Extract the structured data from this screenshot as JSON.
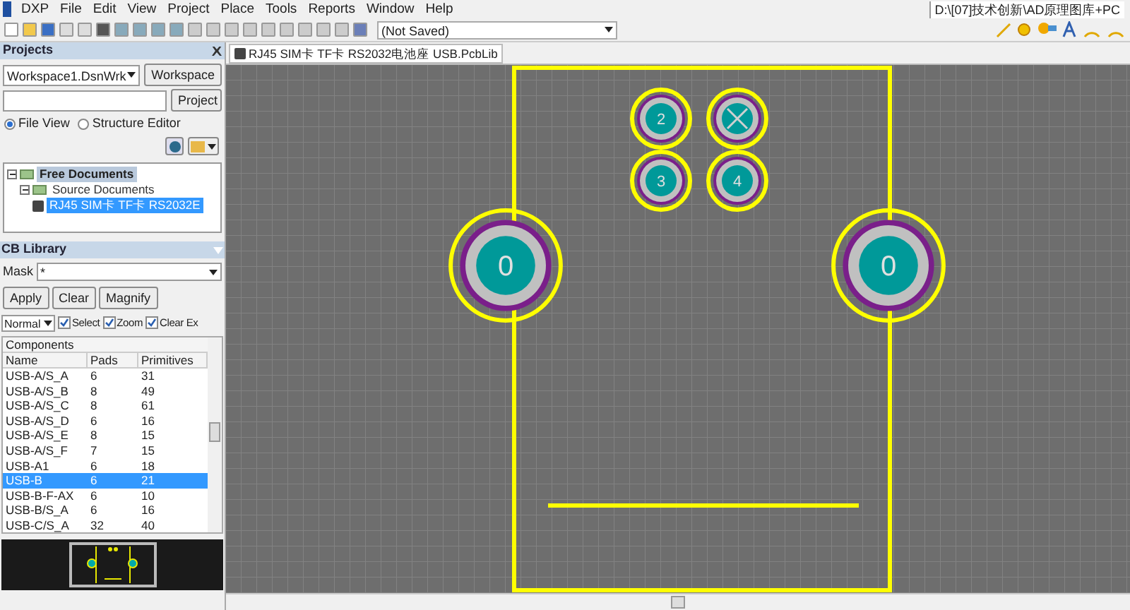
{
  "menu": [
    {
      "label": "DXP"
    },
    {
      "label": "File"
    },
    {
      "label": "Edit"
    },
    {
      "label": "View"
    },
    {
      "label": "Project"
    },
    {
      "label": "Place"
    },
    {
      "label": "Tools"
    },
    {
      "label": "Reports"
    },
    {
      "label": "Window"
    },
    {
      "label": "Help"
    }
  ],
  "path": "D:\\[07]技术创新\\AD原理图库+PC",
  "toolbar": {
    "document_select": "(Not Saved)"
  },
  "projects": {
    "title": "Projects",
    "workspace": "Workspace1.DsnWrk",
    "workspace_button": "Workspace",
    "project_button": "Project",
    "views": [
      {
        "label": "File View",
        "selected": true
      },
      {
        "label": "Structure Editor",
        "selected": false
      }
    ],
    "tree": [
      {
        "label": "Free Documents",
        "expanded": true,
        "selected": false,
        "children": [
          {
            "label": "Source Documents",
            "expanded": true,
            "selected": false,
            "children": [
              {
                "label": "RJ45 SIM卡 TF卡 RS2032E",
                "selected": true
              }
            ]
          }
        ]
      }
    ]
  },
  "document_tab": "RJ45 SIM卡 TF卡 RS2032电池座 USB.PcbLib",
  "pcb_library": {
    "title": "CB Library",
    "mask_label": "Mask",
    "mask": "*",
    "buttons": [
      "Apply",
      "Clear",
      "Magnify"
    ],
    "mode": "Normal",
    "options": [
      {
        "label": "Select",
        "checked": true
      },
      {
        "label": "Zoom",
        "checked": true
      },
      {
        "label": "Clear Ex",
        "checked": true
      }
    ],
    "table_title": "Components",
    "columns": [
      "Name",
      "Pads",
      "Primitives"
    ],
    "rows": [
      {
        "cells": [
          "USB-A/S_A",
          "6",
          "31"
        ],
        "selected": false
      },
      {
        "cells": [
          "USB-A/S_B",
          "8",
          "49"
        ],
        "selected": false
      },
      {
        "cells": [
          "USB-A/S_C",
          "8",
          "61"
        ],
        "selected": false
      },
      {
        "cells": [
          "USB-A/S_D",
          "6",
          "16"
        ],
        "selected": false
      },
      {
        "cells": [
          "USB-A/S_E",
          "8",
          "15"
        ],
        "selected": false
      },
      {
        "cells": [
          "USB-A/S_F",
          "7",
          "15"
        ],
        "selected": false
      },
      {
        "cells": [
          "USB-A1",
          "6",
          "18"
        ],
        "selected": false
      },
      {
        "cells": [
          "USB-B",
          "6",
          "21"
        ],
        "selected": true
      },
      {
        "cells": [
          "USB-B-F-AX",
          "6",
          "10"
        ],
        "selected": false
      },
      {
        "cells": [
          "USB-B/S_A",
          "6",
          "16"
        ],
        "selected": false
      },
      {
        "cells": [
          "USB-C/S_A",
          "32",
          "40"
        ],
        "selected": false
      }
    ]
  },
  "pads": [
    {
      "kind": "small",
      "label": "2"
    },
    {
      "kind": "cross"
    },
    {
      "kind": "small",
      "label": "3"
    },
    {
      "kind": "small",
      "label": "4"
    },
    {
      "kind": "large",
      "label": "0"
    },
    {
      "kind": "large",
      "label": "0"
    }
  ]
}
